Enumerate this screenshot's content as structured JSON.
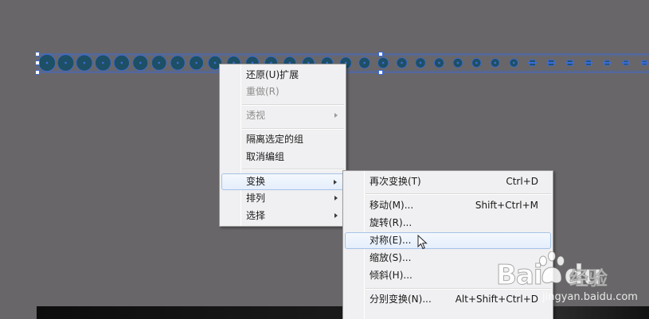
{
  "context_menu": {
    "items": [
      {
        "label": "还原(U)扩展",
        "disabled": false
      },
      {
        "label": "重做(R)",
        "disabled": true
      },
      {
        "label": "透视",
        "disabled": true,
        "submenu": true
      },
      {
        "label": "隔离选定的组",
        "disabled": false
      },
      {
        "label": "取消编组",
        "disabled": false
      },
      {
        "label": "变换",
        "disabled": false,
        "submenu": true,
        "highlighted": true
      },
      {
        "label": "排列",
        "disabled": false,
        "submenu": true
      },
      {
        "label": "选择",
        "disabled": false,
        "submenu": true
      }
    ]
  },
  "transform_submenu": {
    "items": [
      {
        "label": "再次变换(T)",
        "shortcut": "Ctrl+D"
      },
      {
        "label": "移动(M)...",
        "shortcut": "Shift+Ctrl+M"
      },
      {
        "label": "旋转(R)..."
      },
      {
        "label": "对称(E)...",
        "highlighted": true
      },
      {
        "label": "缩放(S)..."
      },
      {
        "label": "倾斜(H)..."
      },
      {
        "label": "分别变换(N)...",
        "shortcut": "Alt+Shift+Ctrl+D"
      }
    ]
  },
  "watermark": {
    "logo": "Bai",
    "logo_suffix": "du",
    "text": "经验",
    "url": "jingyan.baidu.com"
  },
  "colors": {
    "artboard_bg": "#686668",
    "dot_fill": "#1d4f66",
    "selection_blue": "#3d6bd6",
    "menu_bg": "#f0eff1",
    "highlight_border": "#a6c2e8"
  }
}
